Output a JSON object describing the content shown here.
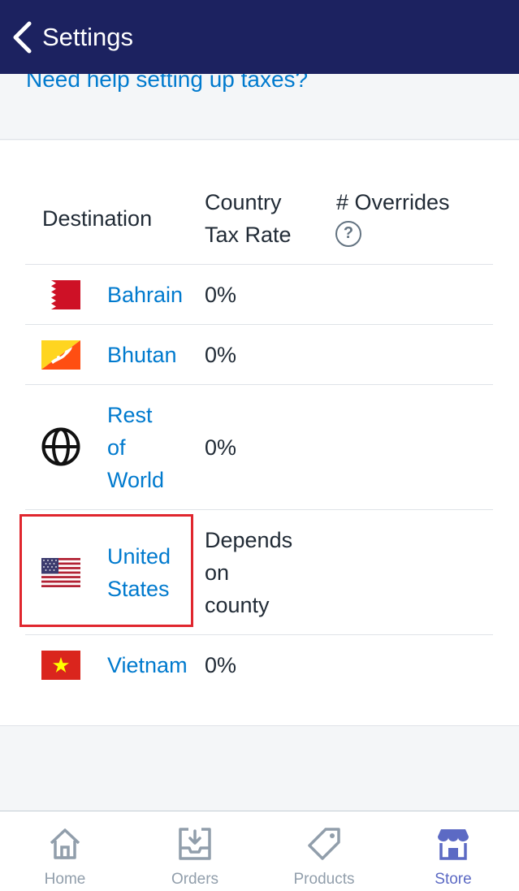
{
  "header": {
    "back_label": "Settings"
  },
  "help": {
    "link_text": "Need help setting up taxes?"
  },
  "table": {
    "headers": {
      "destination": "Destination",
      "rate_line1": "Country",
      "rate_line2": "Tax Rate",
      "overrides": "# Overrides"
    },
    "rows": [
      {
        "country": "Bahrain",
        "rate": "0%",
        "flag_icon": "bahrain-flag-icon"
      },
      {
        "country": "Bhutan",
        "rate": "0%",
        "flag_icon": "bhutan-flag-icon"
      },
      {
        "country_line1": "Rest",
        "country_line2": "of",
        "country_line3": "World",
        "rate": "0%",
        "flag_icon": "globe-icon"
      },
      {
        "country_line1": "United",
        "country_line2": "States",
        "rate_line1": "Depends",
        "rate_line2": "on",
        "rate_line3": "county",
        "flag_icon": "us-flag-icon"
      },
      {
        "country": "Vietnam",
        "rate": "0%",
        "flag_icon": "vietnam-flag-icon"
      }
    ]
  },
  "tabs": [
    {
      "label": "Home",
      "icon": "home-icon",
      "active": false
    },
    {
      "label": "Orders",
      "icon": "orders-icon",
      "active": false
    },
    {
      "label": "Products",
      "icon": "tag-icon",
      "active": false
    },
    {
      "label": "Store",
      "icon": "store-icon",
      "active": true
    }
  ],
  "colors": {
    "header_bg": "#1c2260",
    "link": "#007ace",
    "highlight": "#e0262e",
    "active_tab": "#5c6ac4",
    "inactive_tab": "#919eab"
  }
}
